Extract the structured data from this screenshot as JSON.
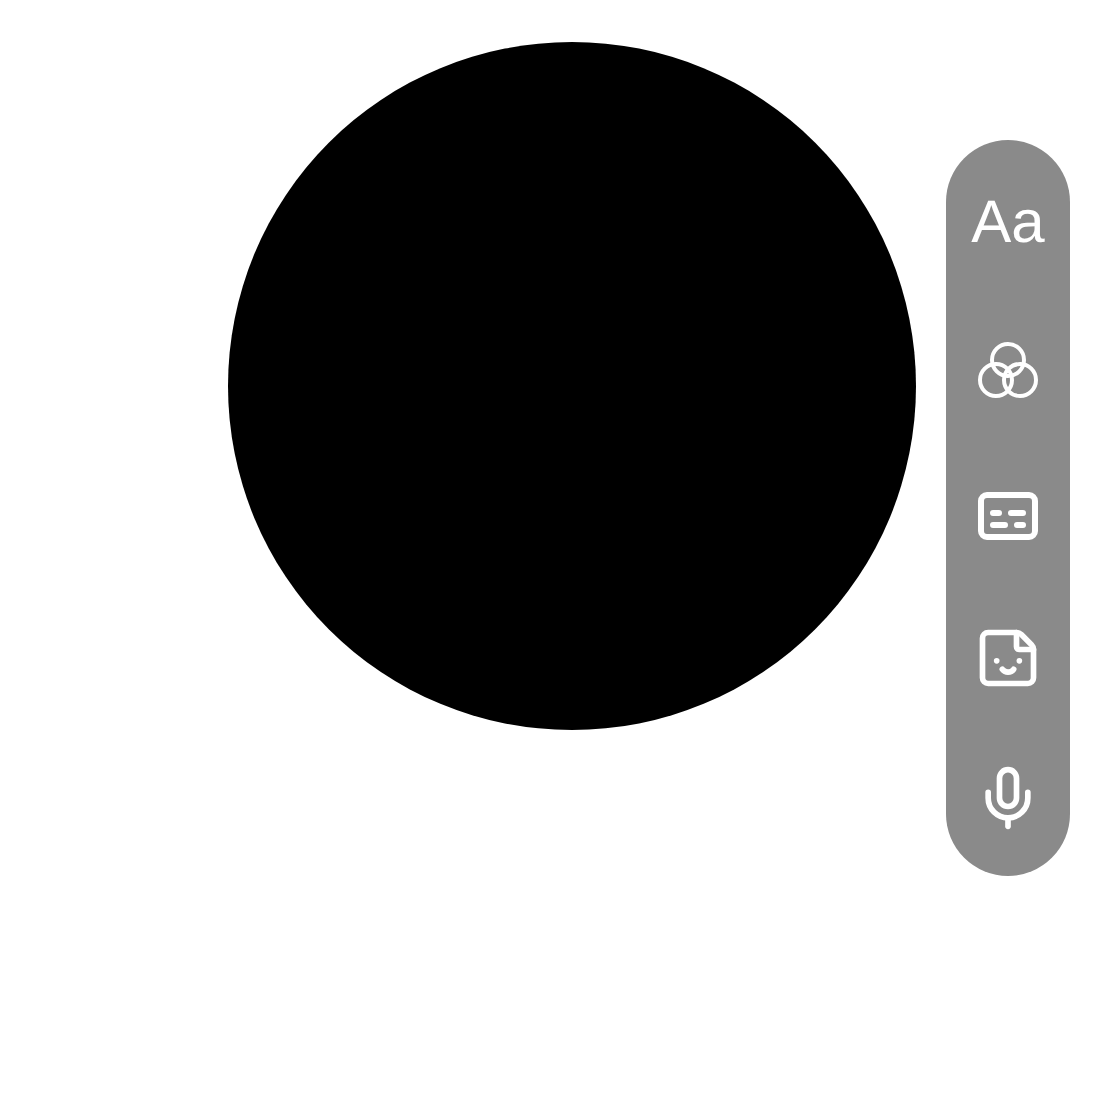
{
  "toolbar": {
    "text_button": "Aa"
  }
}
